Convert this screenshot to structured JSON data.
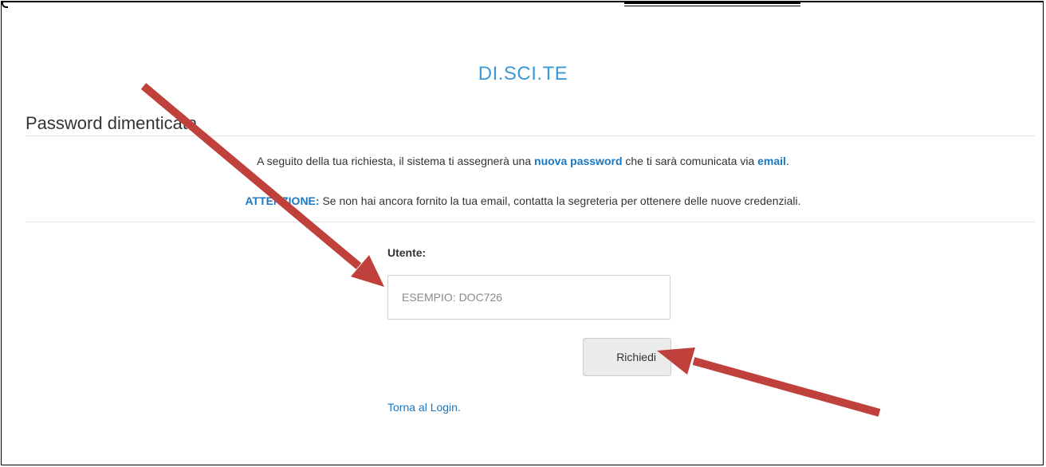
{
  "brand": {
    "title": "DI.SCI.TE"
  },
  "page": {
    "heading": "Password dimenticata"
  },
  "info": {
    "line1_before": "A seguito della tua richiesta, il sistema ti assegnerà una ",
    "line1_strong": "nuova password",
    "line1_middle": " che ti sarà comunicata via ",
    "line1_strong2": "email",
    "line1_after": ".",
    "line2_strong": "ATTENZIONE:",
    "line2_after": " Se non hai ancora fornito la tua email, contatta la segreteria per ottenere delle nuove credenziali."
  },
  "form": {
    "user_label": "Utente:",
    "user_placeholder": "ESEMPIO: DOC726",
    "submit_label": "Richiedi"
  },
  "links": {
    "back_to_login": "Torna al Login."
  },
  "colors": {
    "brand": "#3a9ad9",
    "link": "#1a78c2",
    "arrow": "#c0413c"
  }
}
